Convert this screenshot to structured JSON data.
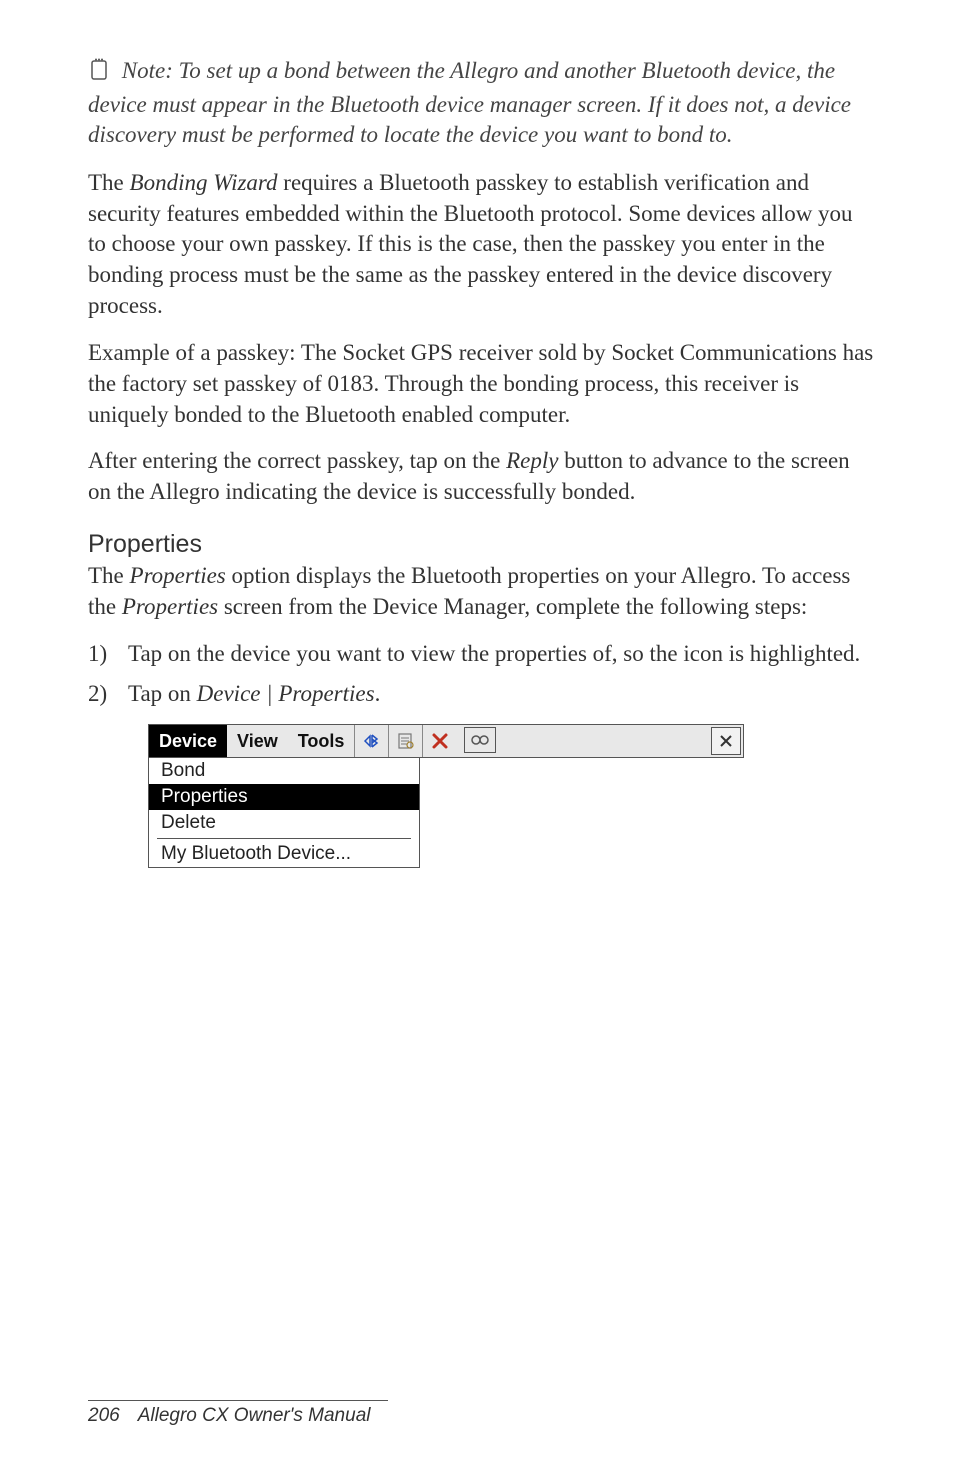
{
  "note": {
    "text_pre": "Note: To set up a bond between the Allegro and another Bluetooth device, the device must appear in the Bluetooth device manager screen. If it does not, a device discovery must be performed to locate the device you want to bond to."
  },
  "para1": {
    "p1": "The ",
    "i1": "Bonding Wizard",
    "p2": " requires a Bluetooth passkey to establish verification and security features embedded within the Bluetooth protocol. Some devices allow you to choose your own passkey. If this is the case, then the passkey you enter in the bonding process must be the same as the passkey entered in the device discovery process."
  },
  "para2": "Example of a passkey: The Socket GPS receiver sold by Socket Communications has the factory set passkey of 0183. Through the bonding process, this receiver is uniquely bonded to the Bluetooth enabled computer.",
  "para3": {
    "p1": "After entering the correct passkey, tap on the ",
    "i1": "Reply",
    "p2": " button to advance to the screen on the Allegro indicating the device is successfully bonded."
  },
  "heading_properties": "Properties",
  "para4": {
    "p1": "The ",
    "i1": "Properties",
    "p2": " option displays the Bluetooth properties on your Allegro. To access the ",
    "i2": "Properties",
    "p3": " screen from the Device Manager, complete the following steps:"
  },
  "steps": [
    {
      "num": "1)",
      "text": "Tap on the device you want to view the properties of, so the icon is highlighted."
    },
    {
      "num": "2)",
      "pre": "Tap on ",
      "i": "Device | Properties",
      "post": "."
    }
  ],
  "menu": {
    "device": "Device",
    "view": "View",
    "tools": "Tools"
  },
  "dropdown": {
    "bond": "Bond",
    "properties": "Properties",
    "delete": "Delete",
    "mydevice": "My Bluetooth Device..."
  },
  "footer": {
    "page": "206",
    "title": "Allegro CX Owner's Manual"
  }
}
